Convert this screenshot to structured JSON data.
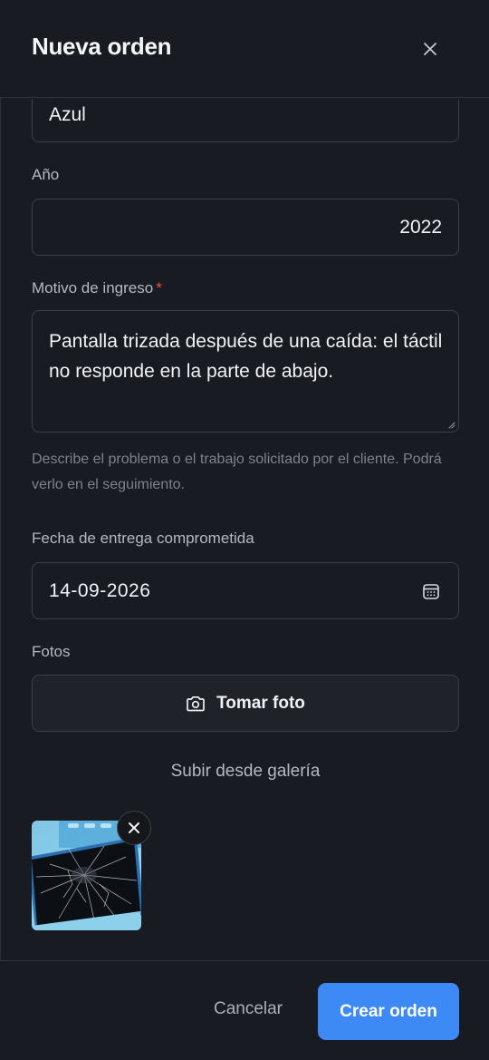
{
  "dialog": {
    "title": "Nueva orden"
  },
  "form": {
    "color": {
      "value": "Azul"
    },
    "year": {
      "label": "Año",
      "value": "2022"
    },
    "reason": {
      "label": "Motivo de ingreso",
      "required_mark": "*",
      "value": "Pantalla trizada después de una caída: el táctil no responde en la parte de abajo.",
      "hint": "Describe el problema o el trabajo solicitado por el cliente. Podrá verlo en el seguimiento."
    },
    "delivery_date": {
      "label": "Fecha de entrega comprometida",
      "value": "14-09-2026",
      "icon": "calendar-icon"
    },
    "photos": {
      "label": "Fotos",
      "take_photo_label": "Tomar foto",
      "take_photo_icon": "camera-icon",
      "upload_label": "Subir desde galería",
      "remove_icon": "close-icon"
    }
  },
  "footer": {
    "cancel_label": "Cancelar",
    "submit_label": "Crear orden"
  },
  "colors": {
    "background": "#181b21",
    "accent": "#3d8af7",
    "required": "#ef4a4a"
  }
}
